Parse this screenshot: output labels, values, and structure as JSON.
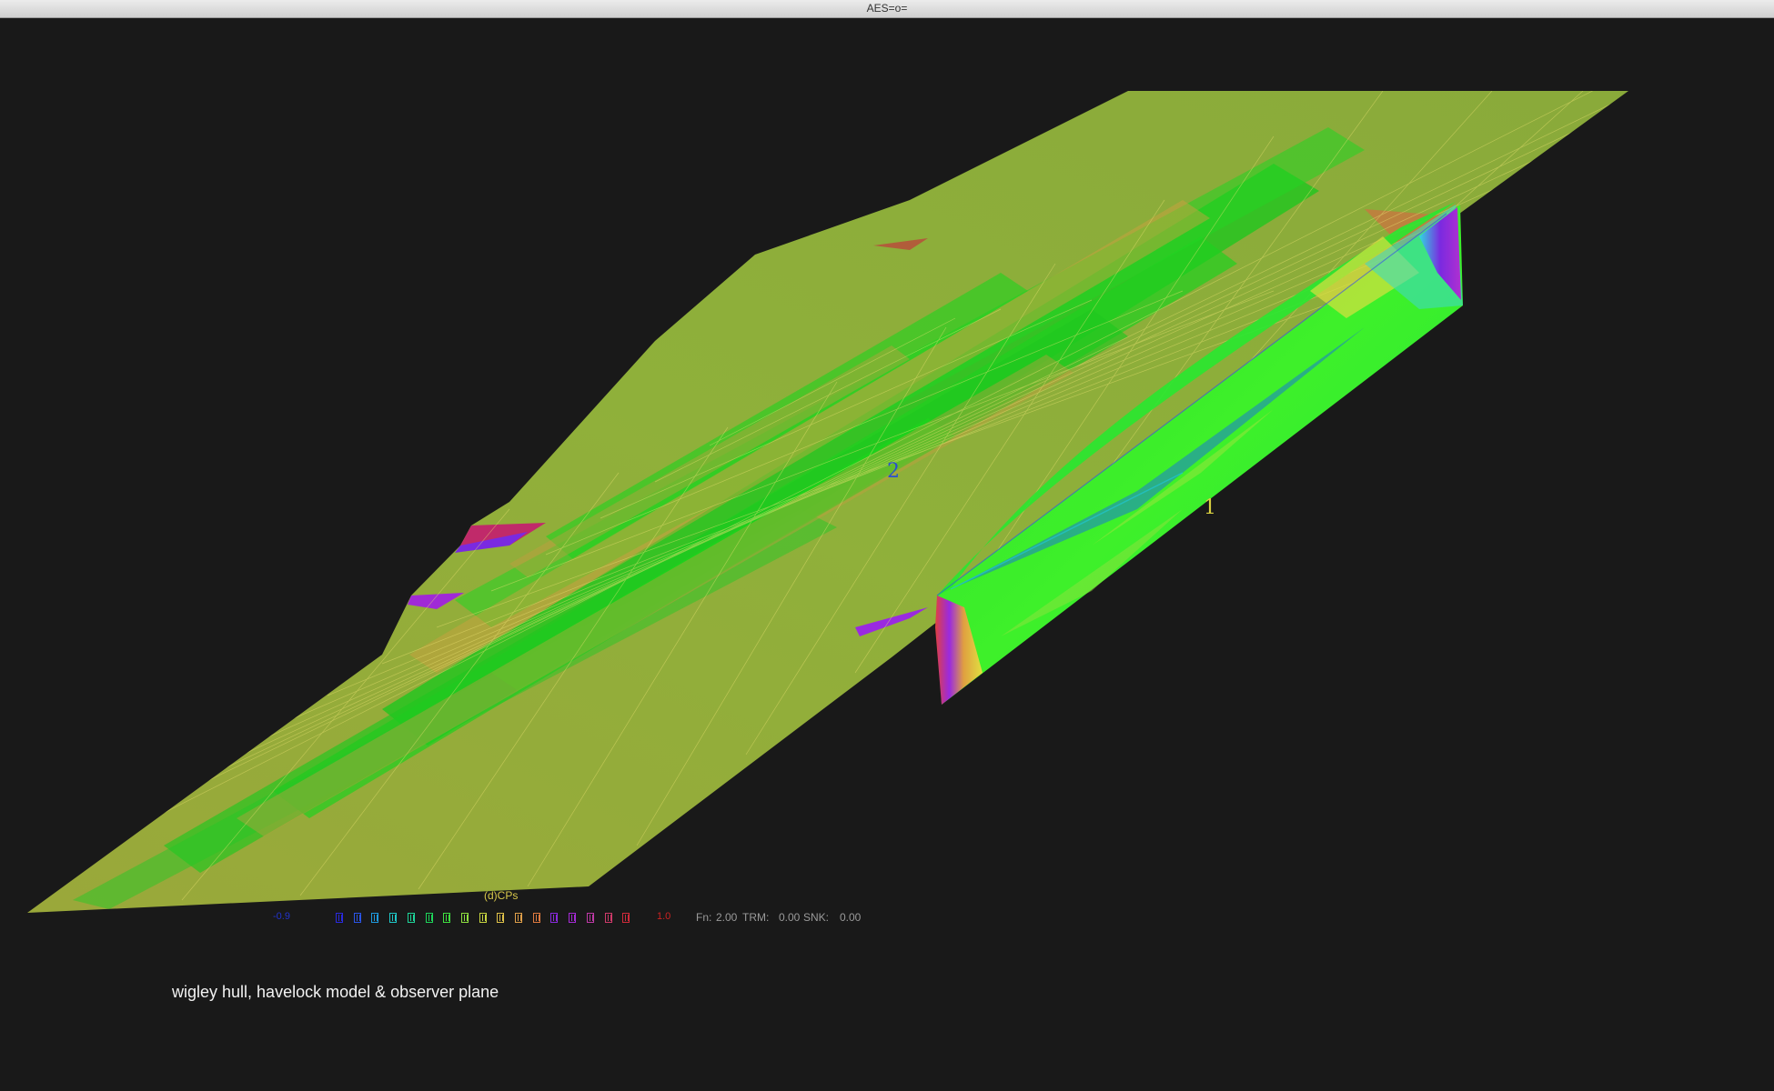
{
  "window": {
    "title": "AES=o="
  },
  "scene": {
    "hull_label": "1",
    "plane_label": "2",
    "hull_label_color": "#d9d040",
    "plane_label_color": "#2a4fd0"
  },
  "legend": {
    "title": "(d)CPs",
    "min": "-0.9",
    "max": "1.0",
    "min_color": "#2233cc",
    "max_color": "#cc2222",
    "title_color": "#d8c84a",
    "swatches": [
      "#2a2ae0",
      "#2a55e8",
      "#1e9ae0",
      "#1ec8c8",
      "#1ed69a",
      "#1ed65a",
      "#3fe03f",
      "#8ee03f",
      "#c8d63f",
      "#e0c24a",
      "#e0a04a",
      "#e07a3f",
      "#8a2ae0",
      "#a52ad6",
      "#c03aa8",
      "#d03a6a",
      "#d02a3a"
    ]
  },
  "status": {
    "fn_label": "Fn:",
    "fn_value": "2.00",
    "trm_label": "TRM:",
    "trm_value": "0.00",
    "snk_label": "SNK:",
    "snk_value": "0.00"
  },
  "caption": "wigley hull, havelock model & observer plane"
}
